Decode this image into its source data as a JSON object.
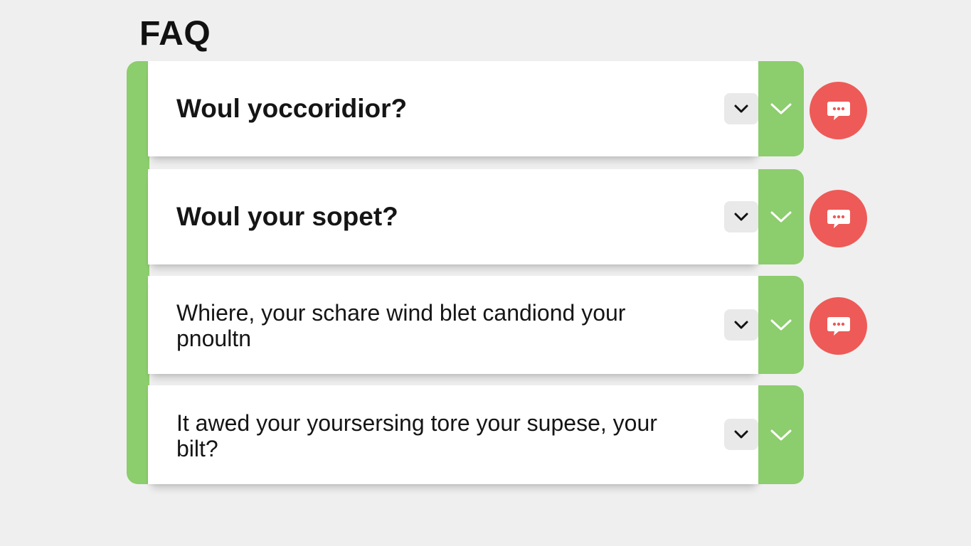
{
  "page": {
    "title": "FAQ"
  },
  "faq": {
    "items": [
      {
        "question": "Woul yoccoridior?"
      },
      {
        "question": "Woul your sopet?"
      },
      {
        "question": "Whiere, your schare wind blet candiond your pnoultn"
      },
      {
        "question": "It awed your yoursersing tore your supese, your bilt?"
      }
    ]
  },
  "icons": {
    "toggle": "chevron-down-icon",
    "tab": "chevron-down-icon",
    "chat": "chat-bubble-icon"
  },
  "colors": {
    "accent_green": "#8ccd6d",
    "chat_red": "#ee5a57",
    "background": "#efefef",
    "toggle_bg": "#e9e9e9"
  }
}
